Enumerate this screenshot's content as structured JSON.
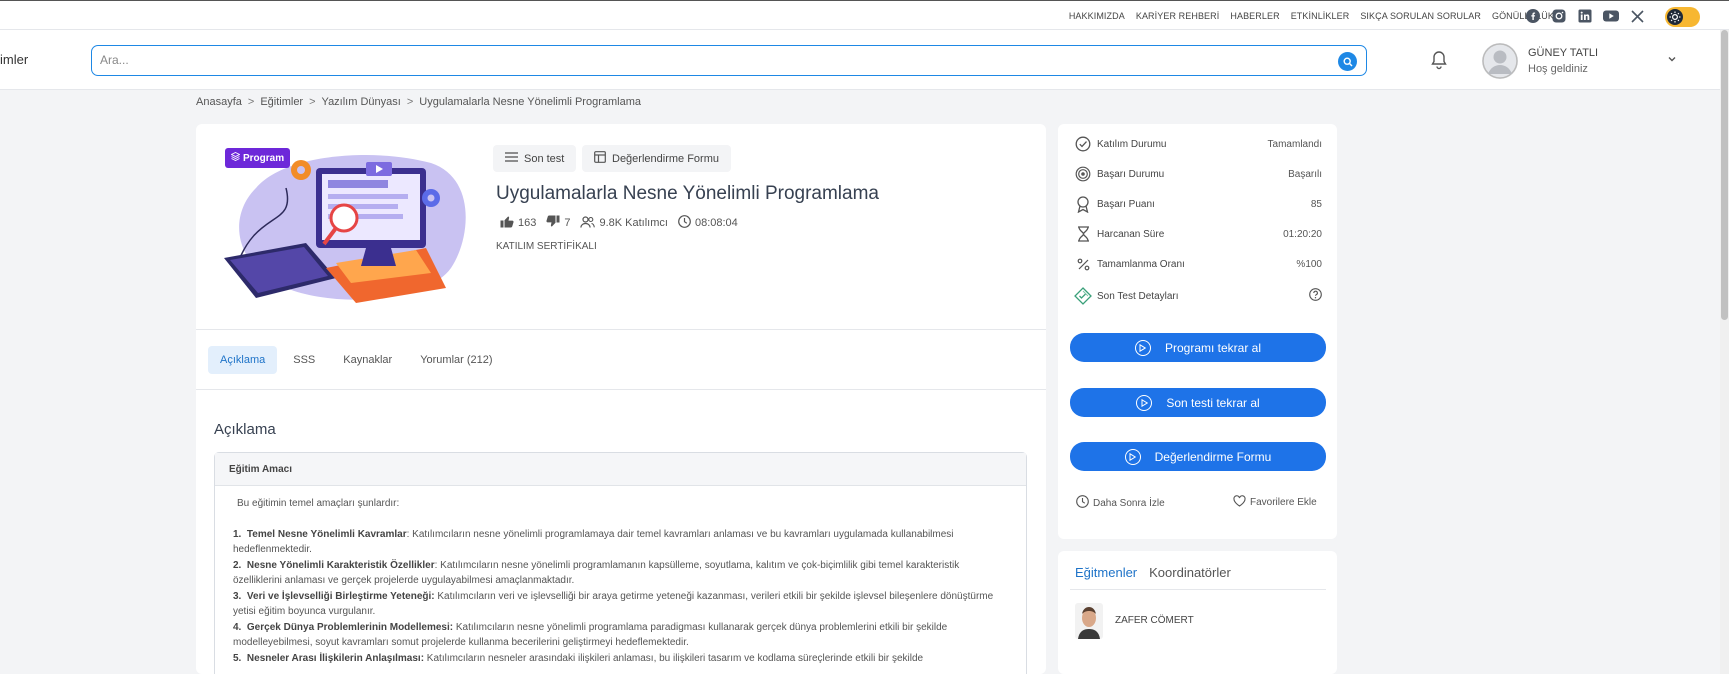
{
  "topbar": {
    "links": [
      "HAKKIMIZDA",
      "KARİYER REHBERİ",
      "HABERLER",
      "ETKİNLİKLER",
      "SIKÇA SORULAN SORULAR",
      "GÖNÜLLÜLÜK"
    ],
    "socials": [
      "facebook-icon",
      "instagram-icon",
      "linkedin-icon",
      "youtube-icon",
      "x-icon"
    ],
    "toggle_color": "#f7b731"
  },
  "header": {
    "left_text": "imler",
    "search_placeholder": "Ara...",
    "user_name": "GÜNEY TATLI",
    "user_greeting": "Hoş geldiniz"
  },
  "breadcrumb": [
    "Anasayfa",
    "Eğitimler",
    "Yazılım Dünyası",
    "Uygulamalarla Nesne Yönelimli Programlama"
  ],
  "course": {
    "badge": "Program",
    "final_test_label": "Son test",
    "evaluation_form_label": "Değerlendirme Formu",
    "title": "Uygulamalarla Nesne Yönelimli Programlama",
    "likes": "163",
    "dislikes": "7",
    "participants": "9.8K Katılımcı",
    "duration": "08:08:04",
    "certificate": "KATILIM SERTİFİKALI"
  },
  "tabs": [
    "Açıklama",
    "SSS",
    "Kaynaklar",
    "Yorumlar (212)"
  ],
  "description": {
    "section_title": "Açıklama",
    "box_title": "Eğitim Amacı",
    "intro": "Bu eğitimin temel amaçları şunlardır:",
    "items": [
      {
        "num": "1.",
        "title": "Temel Nesne Yönelimli Kavramlar",
        "text": ": Katılımcıların nesne yönelimli programlamaya dair temel kavramları anlaması ve bu kavramları uygulamada kullanabilmesi hedeflenmektedir."
      },
      {
        "num": "2.",
        "title": "Nesne Yönelimli Karakteristik Özellikler",
        "text": ": Katılımcıların nesne yönelimli programlamanın kapsülleme, soyutlama, kalıtım ve çok-biçimlilik gibi temel karakteristik özelliklerini anlaması ve gerçek projelerde uygulayabilmesi amaçlanmaktadır."
      },
      {
        "num": "3.",
        "title": "Veri ve İşlevselliği Birleştirme Yeteneği:",
        "text": " Katılımcıların veri ve işlevselliği bir araya getirme yeteneği kazanması, verileri etkili bir şekilde işlevsel bileşenlere dönüştürme yetisi eğitim boyunca vurgulanır."
      },
      {
        "num": "4.",
        "title": "Gerçek Dünya Problemlerinin Modellemesi:",
        "text": " Katılımcıların nesne yönelimli programlama paradigması kullanarak gerçek dünya problemlerini etkili bir şekilde modelleyebilmesi, soyut kavramları somut projelerde kullanma becerilerini geliştirmeyi hedeflemektedir."
      },
      {
        "num": "5.",
        "title": "Nesneler Arası İlişkilerin Anlaşılması:",
        "text": " Katılımcıların nesneler arasındaki ilişkileri anlaması, bu ilişkileri tasarım ve kodlama süreçlerinde etkili bir şekilde"
      }
    ]
  },
  "status": {
    "rows": [
      {
        "label": "Katılım Durumu",
        "value": "Tamamlandı",
        "icon": "check-circle-icon"
      },
      {
        "label": "Başarı Durumu",
        "value": "Başarılı",
        "icon": "target-icon"
      },
      {
        "label": "Başarı Puanı",
        "value": "85",
        "icon": "award-icon"
      },
      {
        "label": "Harcanan Süre",
        "value": "01:20:20",
        "icon": "hourglass-icon"
      },
      {
        "label": "Tamamlanma Oranı",
        "value": "%100",
        "icon": "percent-icon"
      },
      {
        "label": "Son Test Detayları",
        "value": "",
        "icon": "test-details-icon"
      }
    ],
    "buttons": [
      "Programı tekrar al",
      "Son testi tekrar al",
      "Değerlendirme Formu"
    ],
    "watch_later": "Daha Sonra İzle",
    "add_favorite": "Favorilere Ekle",
    "accent": "#1e73e8"
  },
  "instructors": {
    "tabs": [
      "Eğitmenler",
      "Koordinatörler"
    ],
    "name": "ZAFER CÖMERT"
  }
}
